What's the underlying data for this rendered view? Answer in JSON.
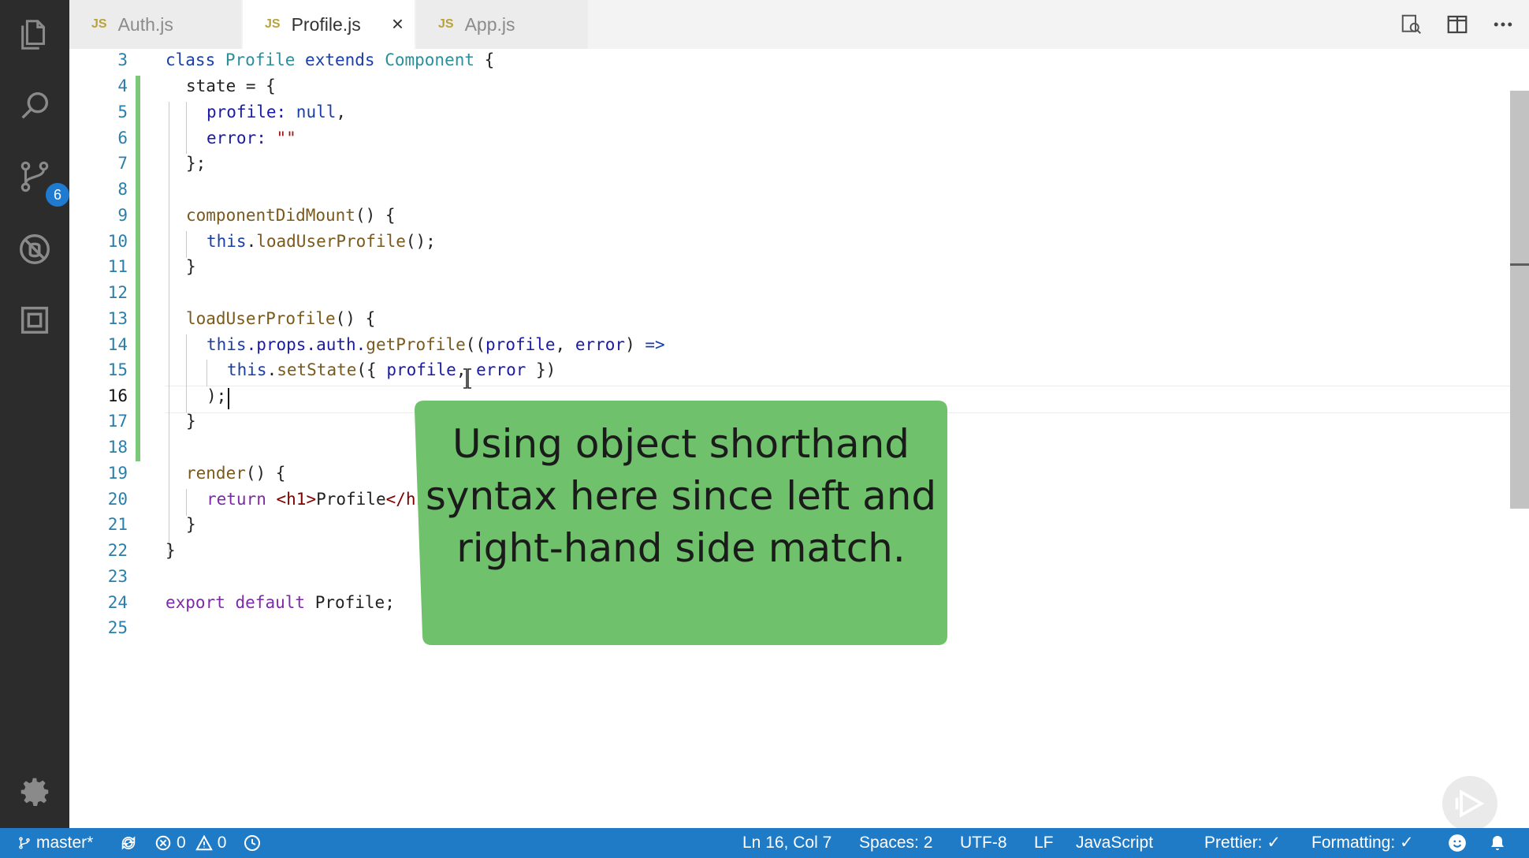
{
  "tabs": [
    {
      "icon": "JS",
      "label": "Auth.js",
      "active": false
    },
    {
      "icon": "JS",
      "label": "Profile.js",
      "active": true
    },
    {
      "icon": "JS",
      "label": "App.js",
      "active": false
    }
  ],
  "tab_close_glyph": "×",
  "activity": {
    "source_control_badge": "6"
  },
  "editor": {
    "current_line": 16,
    "lines": [
      {
        "n": "3"
      },
      {
        "n": "4"
      },
      {
        "n": "5"
      },
      {
        "n": "6"
      },
      {
        "n": "7"
      },
      {
        "n": "8"
      },
      {
        "n": "9"
      },
      {
        "n": "10"
      },
      {
        "n": "11"
      },
      {
        "n": "12"
      },
      {
        "n": "13"
      },
      {
        "n": "14"
      },
      {
        "n": "15"
      },
      {
        "n": "16"
      },
      {
        "n": "17"
      },
      {
        "n": "18"
      },
      {
        "n": "19"
      },
      {
        "n": "20"
      },
      {
        "n": "21"
      },
      {
        "n": "22"
      },
      {
        "n": "23"
      },
      {
        "n": "24"
      },
      {
        "n": "25"
      }
    ],
    "code": {
      "l3": {
        "a": "class",
        "b": "Profile",
        "c": "extends",
        "d": "Component",
        "e": "{"
      },
      "l4": "state = {",
      "l5": {
        "a": "profile: ",
        "b": "null",
        "c": ","
      },
      "l6": {
        "a": "error: ",
        "b": "\"\""
      },
      "l7": "};",
      "l9": {
        "a": "componentDidMount",
        "b": "() {"
      },
      "l10": {
        "a": "this",
        "b": ".",
        "c": "loadUserProfile",
        "d": "();"
      },
      "l11": "}",
      "l13": {
        "a": "loadUserProfile",
        "b": "() {"
      },
      "l14": {
        "a": "this",
        "b": ".props.auth.",
        "c": "getProfile",
        "d": "((",
        "e": "profile",
        "f": ", ",
        "g": "error",
        "h": ") ",
        "i": "=>"
      },
      "l15": {
        "a": "this",
        "b": ".",
        "c": "setState",
        "d": "({ ",
        "e": "profile",
        "f": ", ",
        "g": "error",
        "h": " })"
      },
      "l16": ");",
      "l17": "}",
      "l19": {
        "a": "render",
        "b": "() {"
      },
      "l20": {
        "a": "return",
        "b": "<h1>",
        "c": "Profile",
        "d": "</h1>"
      },
      "l21": "}",
      "l22": "}",
      "l24": {
        "a": "export",
        "b": "default",
        "c": "Profile;"
      }
    }
  },
  "callout": {
    "text": "Using object shorthand syntax here since left and right-hand side match."
  },
  "status": {
    "branch": "master*",
    "errors": "0",
    "warnings": "0",
    "position": "Ln 16, Col 7",
    "spaces": "Spaces: 2",
    "encoding": "UTF-8",
    "eol": "LF",
    "language": "JavaScript",
    "prettier": "Prettier: ✓",
    "formatting": "Formatting: ✓"
  },
  "colors": {
    "status_bar": "#1f7bc5",
    "callout": "#6fc16b",
    "activity_bar": "#2c2c2c"
  }
}
